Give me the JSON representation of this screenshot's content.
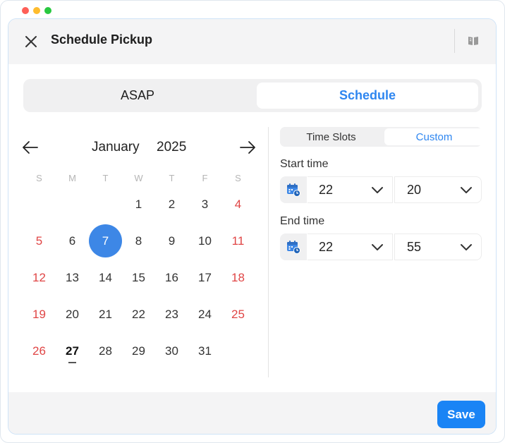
{
  "window": {
    "controls": {
      "close_color": "#fe5f57",
      "minimize_color": "#febc2e",
      "maximize_color": "#28c840"
    }
  },
  "header": {
    "title": "Schedule Pickup",
    "close_icon": "close-icon",
    "right_icon": "book-icon"
  },
  "mode_toggle": {
    "options": [
      "ASAP",
      "Schedule"
    ],
    "selected": "Schedule"
  },
  "calendar": {
    "month": "January",
    "year": "2025",
    "prev_icon": "arrow-left-icon",
    "next_icon": "arrow-right-icon",
    "weekdays": [
      "S",
      "M",
      "T",
      "W",
      "T",
      "F",
      "S"
    ],
    "selected_day": "7",
    "today": "27",
    "weeks": [
      [
        "",
        "",
        "",
        "1",
        "2",
        "3",
        "4"
      ],
      [
        "5",
        "6",
        "7",
        "8",
        "9",
        "10",
        "11"
      ],
      [
        "12",
        "13",
        "14",
        "15",
        "16",
        "17",
        "18"
      ],
      [
        "19",
        "20",
        "21",
        "22",
        "23",
        "24",
        "25"
      ],
      [
        "26",
        "27",
        "28",
        "29",
        "30",
        "31",
        ""
      ]
    ]
  },
  "time_mode": {
    "options": [
      "Time Slots",
      "Custom"
    ],
    "selected": "Custom"
  },
  "start_time": {
    "label": "Start time",
    "hour": "22",
    "minute": "20"
  },
  "end_time": {
    "label": "End time",
    "hour": "22",
    "minute": "55"
  },
  "footer": {
    "save_label": "Save"
  },
  "colors": {
    "accent": "#1a84f5",
    "weekend": "#e04545",
    "selected_day_bg": "#3d87e6"
  }
}
